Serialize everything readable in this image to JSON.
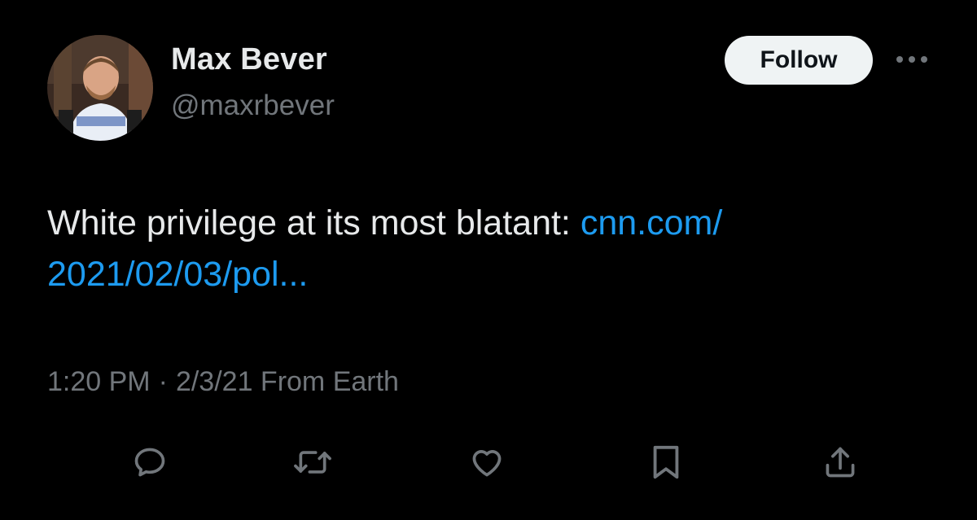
{
  "author": {
    "display_name": "Max Bever",
    "handle": "@maxrbever"
  },
  "header": {
    "follow_label": "Follow",
    "more_icon": "more-horizontal-icon"
  },
  "tweet": {
    "text": "White privilege at its most blatant: ",
    "link_line1": "cnn.com/",
    "link_line2": "2021/02/03/pol..."
  },
  "meta": {
    "time": "1:20 PM",
    "separator": "·",
    "date_source": "2/3/21 From Earth"
  },
  "actions": {
    "reply_icon": "reply-icon",
    "retweet_icon": "retweet-icon",
    "like_icon": "heart-icon",
    "bookmark_icon": "bookmark-icon",
    "share_icon": "share-icon"
  },
  "colors": {
    "background": "#000000",
    "primary_text": "#e7e9ea",
    "secondary_text": "#71767b",
    "link": "#1d9bf0",
    "follow_bg": "#eff3f4"
  }
}
